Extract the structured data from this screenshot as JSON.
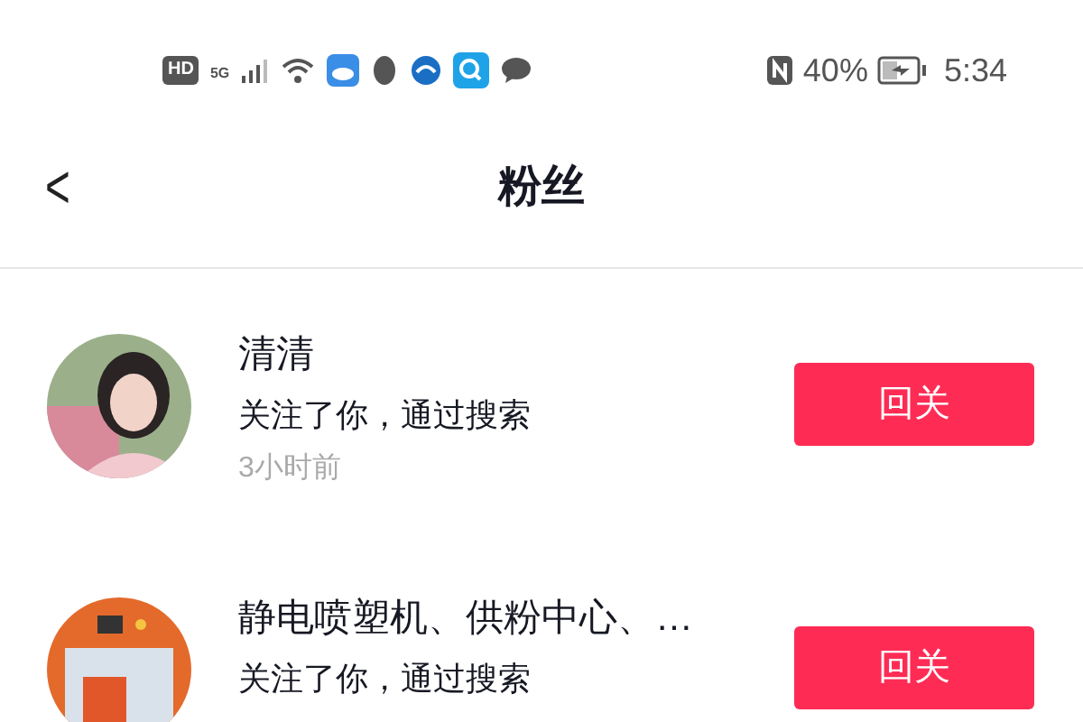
{
  "status_bar": {
    "hd": "HD",
    "network": "5G",
    "battery": "40%",
    "time": "5:34"
  },
  "header": {
    "back": "<",
    "title": "粉丝"
  },
  "followers": [
    {
      "name": "清清",
      "message": "关注了你，通过搜索",
      "time": "3小时前",
      "button": "回关"
    },
    {
      "name": "静电喷塑机、供粉中心、…",
      "message": "关注了你，通过搜索",
      "button": "回关"
    }
  ]
}
